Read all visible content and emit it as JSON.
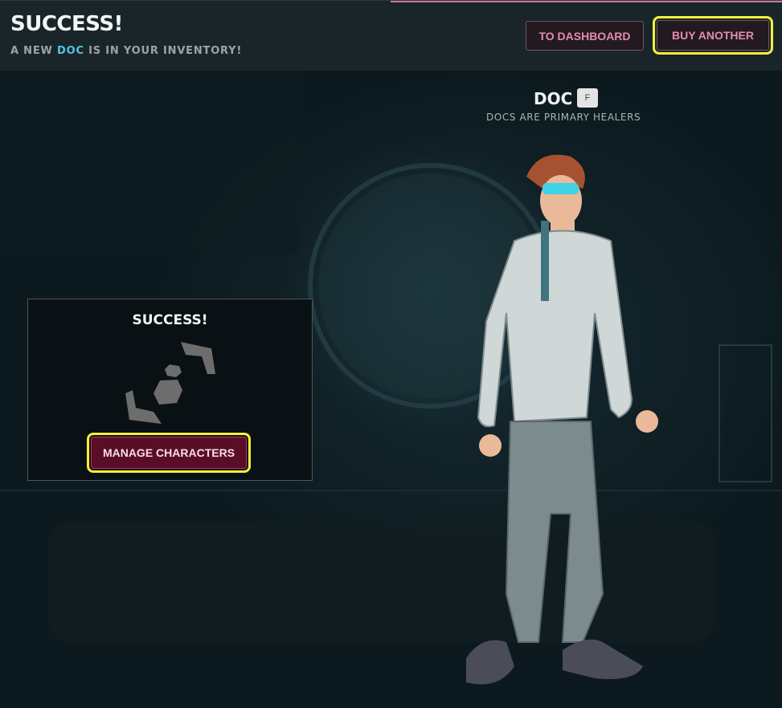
{
  "header": {
    "title": "SUCCESS!",
    "subtitle_prefix": "A NEW",
    "subtitle_highlight": "DOC",
    "subtitle_suffix": "IS IN YOUR INVENTORY!",
    "dashboard_button": "TO DASHBOARD",
    "buy_another_button": "BUY ANOTHER"
  },
  "character": {
    "name": "DOC",
    "badge": "F",
    "description": "DOCS ARE PRIMARY HEALERS"
  },
  "success_panel": {
    "title": "SUCCESS!",
    "manage_button": "MANAGE CHARACTERS",
    "icon": "character-swap-icon"
  },
  "colors": {
    "accent_pink": "#e38bb2",
    "highlight_cyan": "#4fc7e5",
    "button_crimson": "#5a0e25",
    "annotation_yellow": "#f3ef3a"
  }
}
